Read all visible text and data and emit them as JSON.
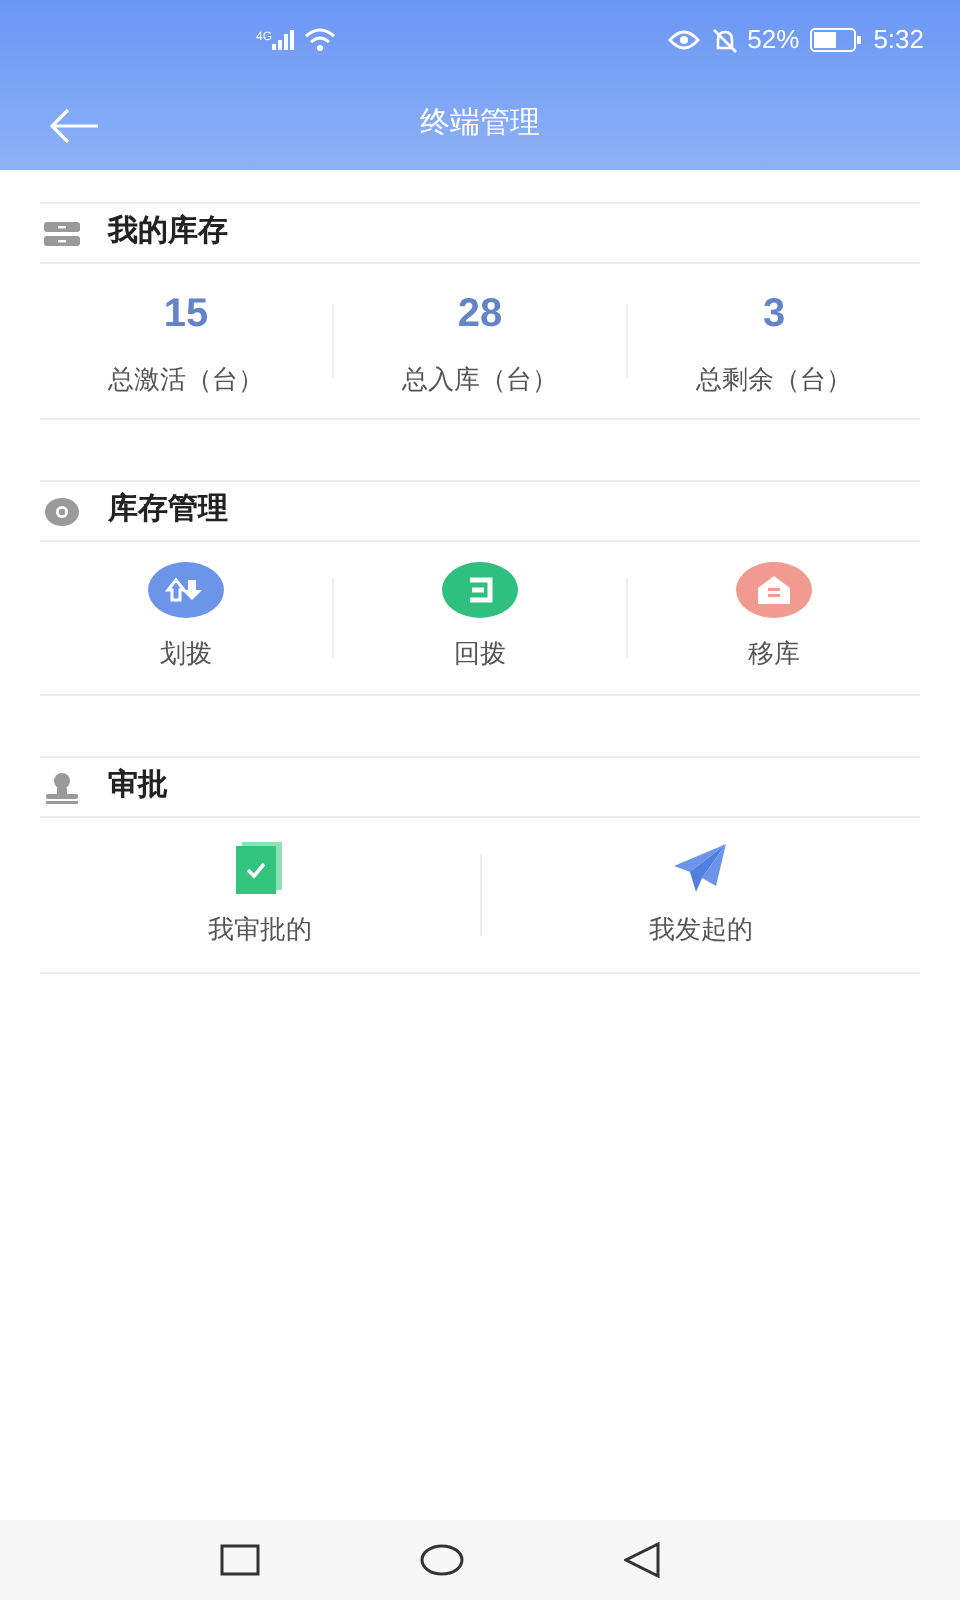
{
  "status_bar": {
    "network": "4G",
    "battery": "52%",
    "time": "5:32"
  },
  "header": {
    "title": "终端管理"
  },
  "inventory": {
    "title": "我的库存",
    "stats": [
      {
        "value": "15",
        "label": "总激活（台）"
      },
      {
        "value": "28",
        "label": "总入库（台）"
      },
      {
        "value": "3",
        "label": "总剩余（台）"
      }
    ]
  },
  "management": {
    "title": "库存管理",
    "actions": [
      {
        "kind": "transfer",
        "label": "划拨"
      },
      {
        "kind": "return",
        "label": "回拨"
      },
      {
        "kind": "move",
        "label": "移库"
      }
    ]
  },
  "approval": {
    "title": "审批",
    "actions": [
      {
        "kind": "approved",
        "label": "我审批的"
      },
      {
        "kind": "initiated",
        "label": "我发起的"
      }
    ]
  }
}
